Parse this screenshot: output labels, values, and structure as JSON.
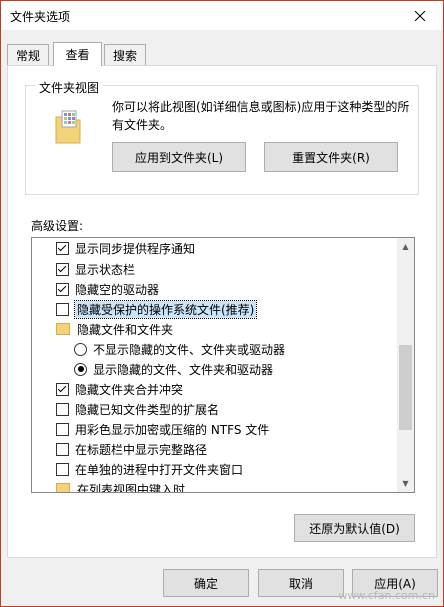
{
  "window": {
    "title": "文件夹选项"
  },
  "tabs": [
    {
      "label": "常规",
      "active": false
    },
    {
      "label": "查看",
      "active": true
    },
    {
      "label": "搜索",
      "active": false
    }
  ],
  "folder_views": {
    "group_label": "文件夹视图",
    "description": "你可以将此视图(如详细信息或图标)应用于这种类型的所有文件夹。",
    "apply_button": "应用到文件夹(L)",
    "reset_button": "重置文件夹(R)"
  },
  "advanced": {
    "label": "高级设置:",
    "items": [
      {
        "type": "checkbox",
        "checked": true,
        "label": "显示同步提供程序通知"
      },
      {
        "type": "checkbox",
        "checked": true,
        "label": "显示状态栏"
      },
      {
        "type": "checkbox",
        "checked": true,
        "label": "隐藏空的驱动器"
      },
      {
        "type": "checkbox",
        "checked": false,
        "label": "隐藏受保护的操作系统文件(推荐)",
        "selected": true
      },
      {
        "type": "folder",
        "label": "隐藏文件和文件夹"
      },
      {
        "type": "radio",
        "checked": false,
        "label": "不显示隐藏的文件、文件夹或驱动器"
      },
      {
        "type": "radio",
        "checked": true,
        "label": "显示隐藏的文件、文件夹和驱动器"
      },
      {
        "type": "checkbox",
        "checked": true,
        "label": "隐藏文件夹合并冲突"
      },
      {
        "type": "checkbox",
        "checked": false,
        "label": "隐藏已知文件类型的扩展名"
      },
      {
        "type": "checkbox",
        "checked": false,
        "label": "用彩色显示加密或压缩的 NTFS 文件"
      },
      {
        "type": "checkbox",
        "checked": false,
        "label": "在标题栏中显示完整路径"
      },
      {
        "type": "checkbox",
        "checked": false,
        "label": "在单独的进程中打开文件夹窗口"
      },
      {
        "type": "folder",
        "label": "在列表视图中键入时"
      }
    ],
    "restore_button": "还原为默认值(D)"
  },
  "footer": {
    "ok_button": "确定",
    "cancel_button": "取消",
    "apply_button": "应用(A)"
  },
  "watermark": "www.cfan.com.cn",
  "colors": {
    "border_accent": "#c23b22",
    "selection": "#cce4f7",
    "button_bg": "#e1e1e1",
    "folder": "#f4d27a"
  }
}
